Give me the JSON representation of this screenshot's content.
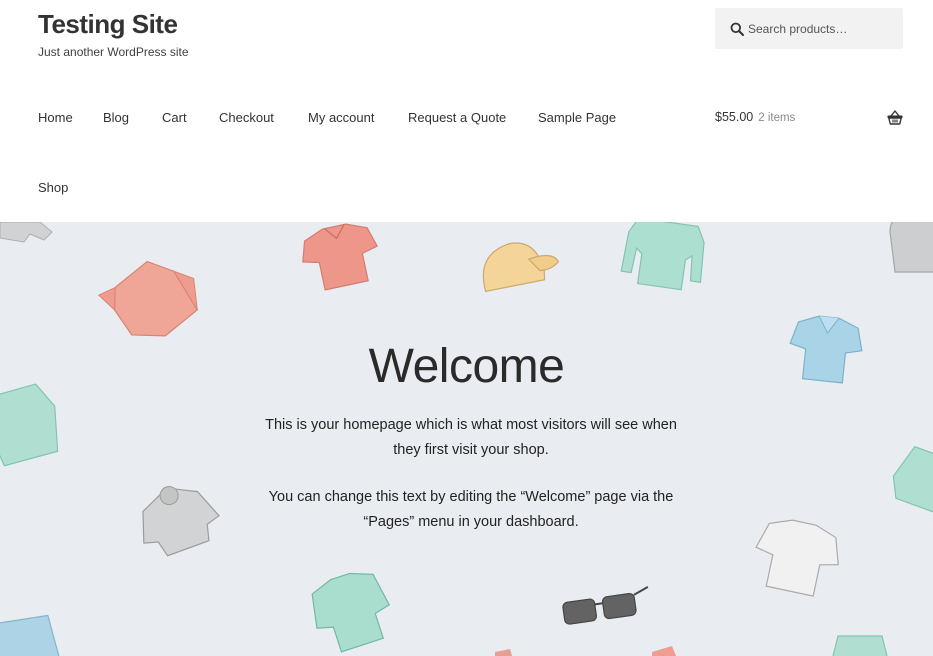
{
  "header": {
    "site_title": "Testing Site",
    "tagline": "Just another WordPress site"
  },
  "search": {
    "placeholder": "Search products…",
    "value": ""
  },
  "nav": {
    "items": [
      {
        "label": "Home"
      },
      {
        "label": "Blog"
      },
      {
        "label": "Cart"
      },
      {
        "label": "Checkout"
      },
      {
        "label": "My account"
      },
      {
        "label": "Request a Quote"
      },
      {
        "label": "Sample Page"
      },
      {
        "label": "Shop"
      }
    ]
  },
  "cart": {
    "total": "$55.00",
    "count": "2 items",
    "icon": "basket-icon"
  },
  "hero": {
    "title": "Welcome",
    "paragraph1": "This is your homepage which is what most visitors will see when they first visit your shop.",
    "paragraph2": "You can change this text by editing the “Welcome” page via the “Pages” menu in your dashboard.",
    "background_color": "#e9edf2"
  }
}
